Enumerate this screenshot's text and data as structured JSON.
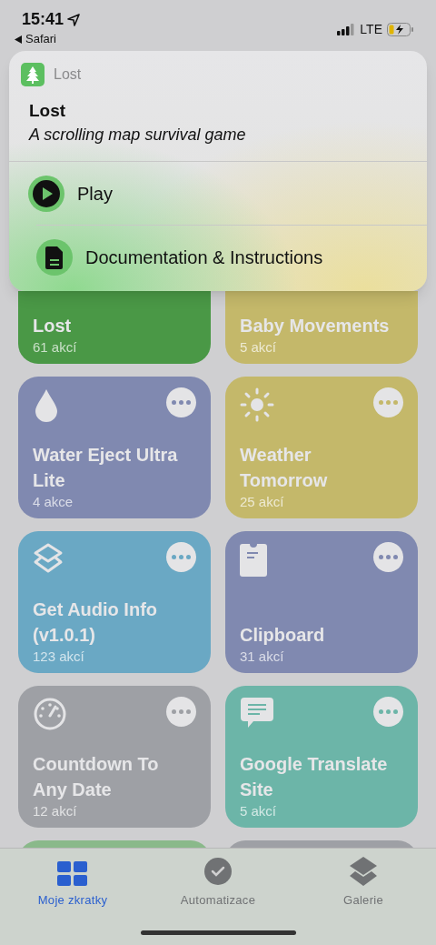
{
  "status_bar": {
    "time": "15:41",
    "back_label": "Safari",
    "network": "LTE"
  },
  "popup": {
    "app_name": "Lost",
    "title": "Lost",
    "subtitle": "A scrolling map survival game",
    "actions": [
      {
        "kind": "play",
        "label": "Play"
      },
      {
        "kind": "document",
        "label": "Documentation & Instructions"
      }
    ]
  },
  "shortcuts": [
    {
      "kind": "covered",
      "title": "Lost",
      "count": "61 akcí",
      "color": "#4a9846"
    },
    {
      "kind": "covered",
      "title": "Baby Movements",
      "count": "5 akcí",
      "color": "#c4b86a"
    },
    {
      "kind": "full",
      "title": "Water Eject Ultra Lite",
      "count": "4 akce",
      "color": "#8089b0"
    },
    {
      "kind": "full",
      "title": "Weather Tomorrow",
      "count": "25 akcí",
      "color": "#c4b86a"
    },
    {
      "kind": "full",
      "title": "Get Audio Info (v1.0.1)",
      "count": "123 akcí",
      "color": "#6aa8c4"
    },
    {
      "kind": "full",
      "title": "Clipboard",
      "count": "31 akcí",
      "color": "#8089b0"
    },
    {
      "kind": "full",
      "title": "Countdown To Any Date",
      "count": "12 akcí",
      "color": "#9ea0a5"
    },
    {
      "kind": "full",
      "title": "Google Translate Site",
      "count": "5 akcí",
      "color": "#6cb5a8"
    },
    {
      "kind": "edge",
      "color": "#8ab98a"
    },
    {
      "kind": "edge",
      "color": "#9ea0a5"
    }
  ],
  "tabs": [
    {
      "label": "Moje zkratky",
      "selected": true
    },
    {
      "label": "Automatizace",
      "selected": false
    },
    {
      "label": "Galerie",
      "selected": false
    }
  ]
}
